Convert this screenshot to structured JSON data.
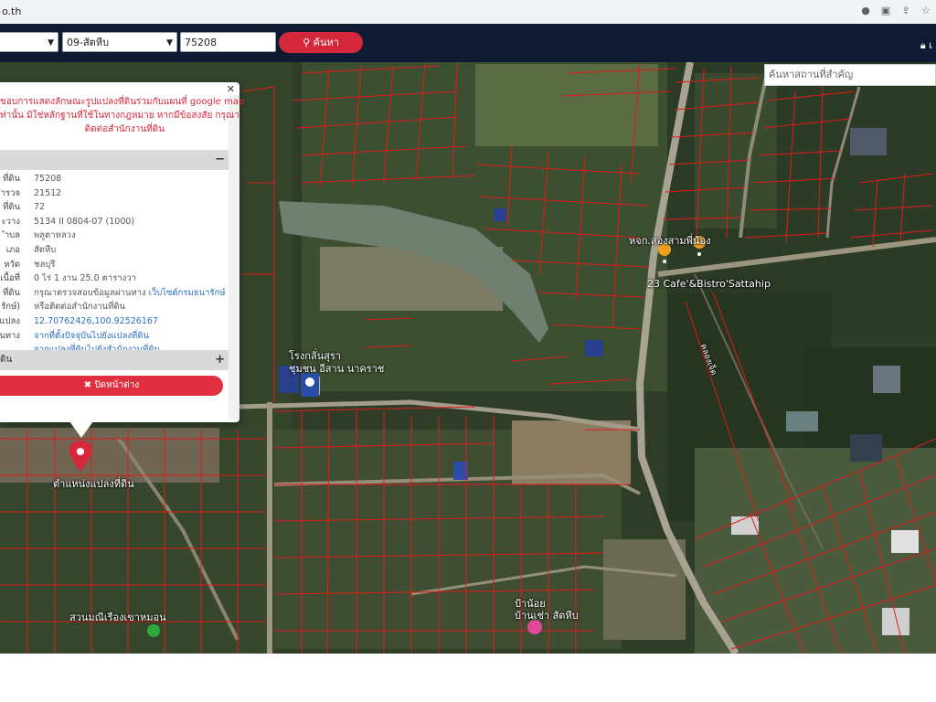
{
  "browser": {
    "url": "o.th",
    "icons": [
      "profile-icon",
      "translate-icon",
      "share-icon",
      "star-icon"
    ]
  },
  "navbar": {
    "province_select": "",
    "district_select": "09-สัตหีบ",
    "parcel_number": "75208",
    "search_button": "ค้นหา",
    "user_label": "เ"
  },
  "map": {
    "place_search_placeholder": "ค้นหาสถานที่สำคัญ",
    "labels": {
      "junction": "หจก.สองสามพี่น้อง",
      "cafe": "23 Cafe'&Bistro'Sattahip",
      "factory_line1": "โรงกลั่นสุรา",
      "factory_line2": "ชุมชน อีสาน นาคราช",
      "parcel_marker": "ตำแหน่งแปลงที่ดิน",
      "park": "สวนมณีเรืองเขาหมอน",
      "shop_line1": "ป้าน้อย",
      "shop_line2": "บ้านเช่า สัตหีบ",
      "road": "คลองเจ็ด"
    }
  },
  "popup": {
    "notice_lines": [
      "ขอบการแสดงลักษณะรูปแปลงที่ดินร่วมกับแผนที่ google map",
      "ท่านั้น มิใช่หลักฐานที่ใช้ในทางกฎหมาย หากมีข้อสงสัย กรุณา",
      "ติดต่อสำนักงานที่ดิน"
    ],
    "section_top": "",
    "rows": [
      {
        "key": "ที่ดิน",
        "value": "75208"
      },
      {
        "key": "ำรวจ",
        "value": "21512"
      },
      {
        "key": "ที่ดิน",
        "value": "72"
      },
      {
        "key": "ะวาง",
        "value": "5134 II 0804-07 (1000)"
      },
      {
        "key": "ำบล",
        "value": "พลูตาหลวง"
      },
      {
        "key": "เภอ",
        "value": "สัตหีบ"
      },
      {
        "key": "หวัด",
        "value": "ชลบุรี"
      },
      {
        "key": "เนื้อที่",
        "value": "0 ไร่ 1 งาน 25.0 ตารางวา"
      },
      {
        "key": "ที่ดิน",
        "value": "กรุณาตรวจสอบข้อมูลผ่านทาง ",
        "link": "เว็บไซต์กรมธนารักษ์"
      },
      {
        "key": "รักษ์)",
        "value": "หรือติดต่อสำนักงานที่ดิน"
      },
      {
        "key": "แปลง",
        "value": "",
        "link": "12.70762426,100.92526167"
      },
      {
        "key": "นทาง",
        "value": "",
        "link": "จากที่ตั้งปัจจุบันไปยังแปลงที่ดิน"
      },
      {
        "key": "",
        "value": "",
        "link": "จากแปลงที่ดินไปยังสำนักงานที่ดิน"
      }
    ],
    "section_bottom": "ดิน",
    "close_window_button": "✖ ปิดหน้าต่าง"
  },
  "colors": {
    "nav_bg": "#0f1b33",
    "accent": "#d6283c",
    "parcel_line": "#e01a1a"
  }
}
